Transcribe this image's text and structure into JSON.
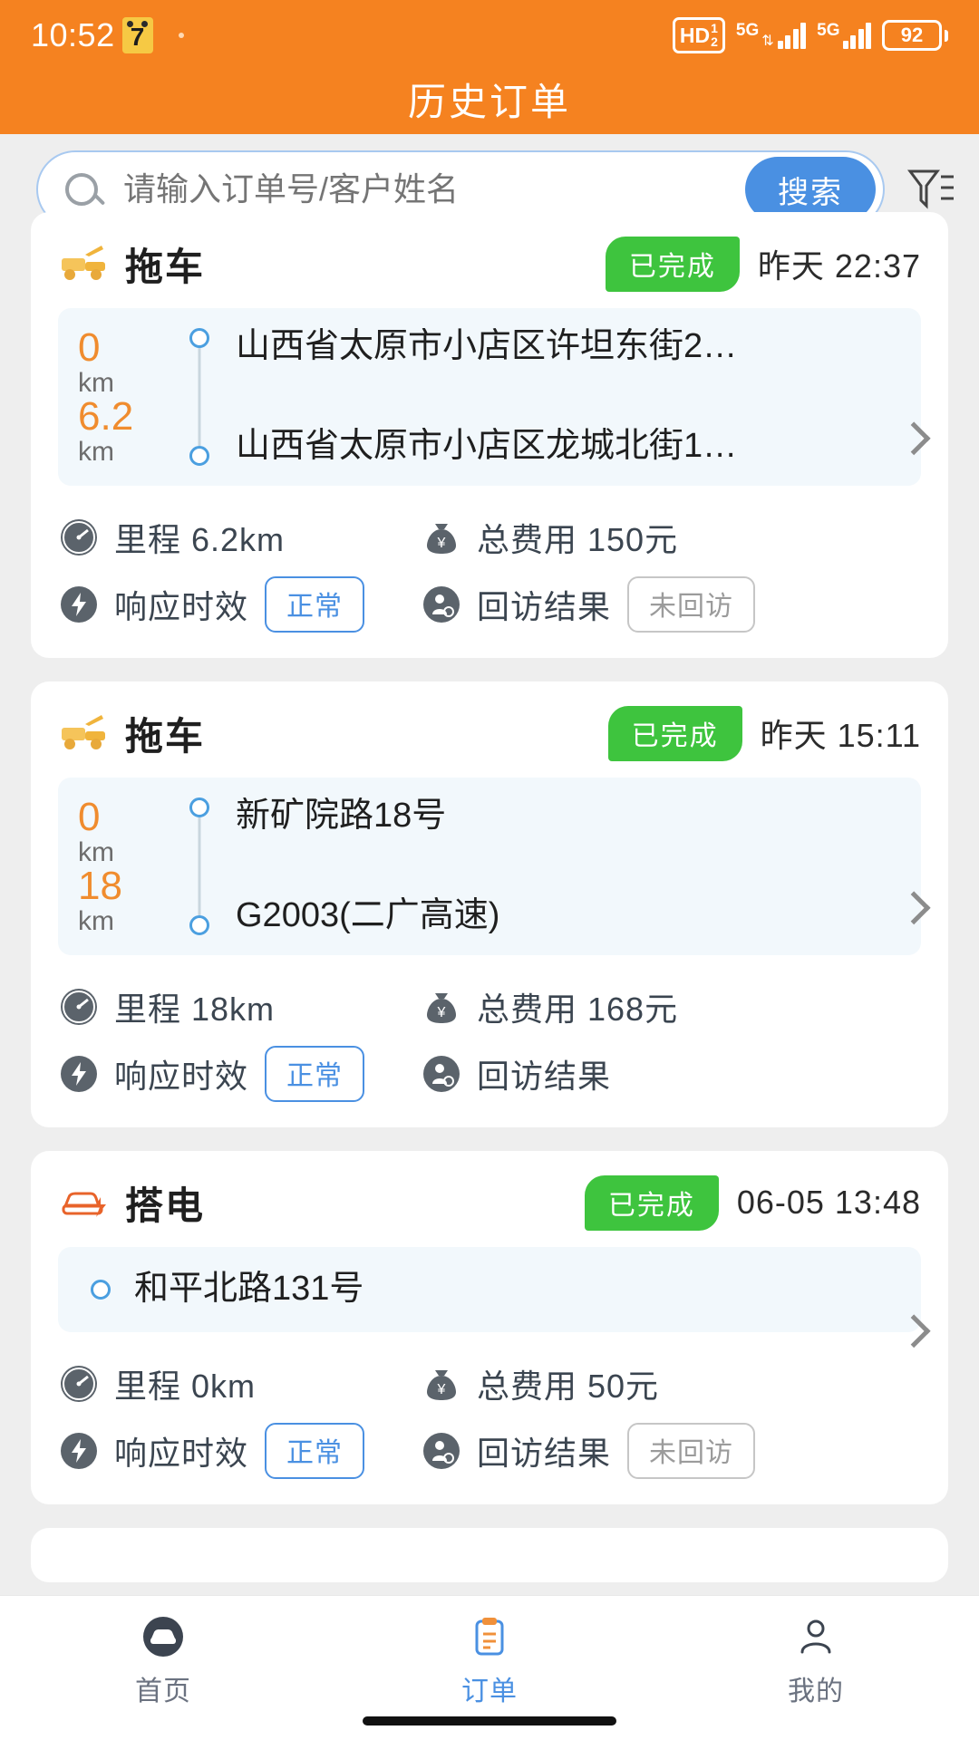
{
  "status_bar": {
    "time": "10:52",
    "badge_text": "7",
    "hd_label": "HD",
    "hd_sup": "1",
    "hd_sub": "2",
    "sim1_network": "5G",
    "sim2_network": "5G",
    "battery_percent": "92"
  },
  "header": {
    "title": "历史订单"
  },
  "search": {
    "placeholder": "请输入订单号/客户姓名",
    "button_label": "搜索",
    "filter_icon": "filter-icon"
  },
  "colors": {
    "brand_orange": "#f58220",
    "accent_blue": "#4a90e2",
    "status_green": "#3ec43e",
    "km_orange": "#f08c2e"
  },
  "orders": [
    {
      "service": "拖车",
      "service_icon": "tow-truck-icon",
      "status": "已完成",
      "time": "昨天 22:37",
      "stops": [
        {
          "km": "0",
          "unit": "km",
          "address": "山西省太原市小店区许坦东街2…"
        },
        {
          "km": "6.2",
          "unit": "km",
          "address": "山西省太原市小店区龙城北街1…"
        }
      ],
      "mileage_label": "里程 6.2km",
      "fee_label": "总费用 150元",
      "response_label": "响应时效",
      "response_value": "正常",
      "followup_label": "回访结果",
      "followup_value": "未回访"
    },
    {
      "service": "拖车",
      "service_icon": "tow-truck-icon",
      "status": "已完成",
      "time": "昨天 15:11",
      "stops": [
        {
          "km": "0",
          "unit": "km",
          "address": "新矿院路18号"
        },
        {
          "km": "18",
          "unit": "km",
          "address": "G2003(二广高速)"
        }
      ],
      "mileage_label": "里程 18km",
      "fee_label": "总费用 168元",
      "response_label": "响应时效",
      "response_value": "正常",
      "followup_label": "回访结果",
      "followup_value": ""
    },
    {
      "service": "搭电",
      "service_icon": "jump-start-icon",
      "status": "已完成",
      "time": "06-05 13:48",
      "stops": [
        {
          "km": "",
          "unit": "",
          "address": "和平北路131号"
        }
      ],
      "mileage_label": "里程 0km",
      "fee_label": "总费用 50元",
      "response_label": "响应时效",
      "response_value": "正常",
      "followup_label": "回访结果",
      "followup_value": "未回访"
    }
  ],
  "bottom_nav": {
    "items": [
      {
        "label": "首页",
        "icon": "home-car-icon",
        "active": false
      },
      {
        "label": "订单",
        "icon": "order-list-icon",
        "active": true
      },
      {
        "label": "我的",
        "icon": "person-icon",
        "active": false
      }
    ]
  }
}
